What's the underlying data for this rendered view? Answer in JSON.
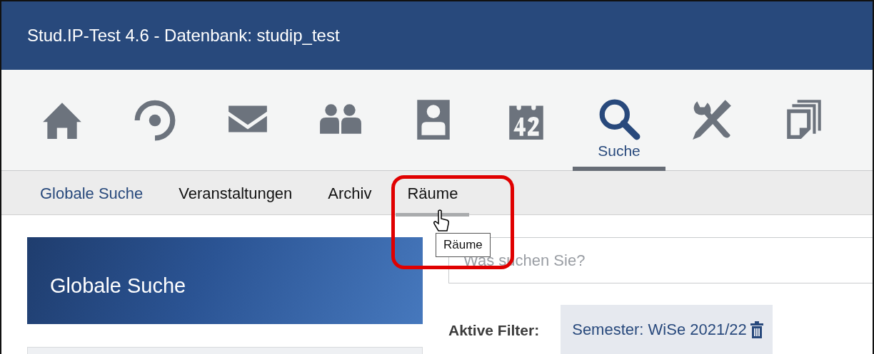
{
  "window": {
    "title": "Stud.IP-Test 4.6 - Datenbank: studip_test"
  },
  "nav": [
    {
      "kind": "home",
      "selected": false
    },
    {
      "kind": "activity",
      "selected": false
    },
    {
      "kind": "messages",
      "selected": false
    },
    {
      "kind": "community",
      "selected": false
    },
    {
      "kind": "profile",
      "selected": false
    },
    {
      "kind": "calendar",
      "selected": false
    },
    {
      "kind": "search",
      "label": "Suche",
      "selected": true
    },
    {
      "kind": "tools",
      "selected": false
    },
    {
      "kind": "files",
      "selected": false
    }
  ],
  "subnav": [
    {
      "label": "Globale Suche",
      "selected": true,
      "hovered": false
    },
    {
      "label": "Veranstaltungen",
      "selected": false,
      "hovered": false
    },
    {
      "label": "Archiv",
      "selected": false,
      "hovered": false
    },
    {
      "label": "Räume",
      "selected": false,
      "hovered": true
    }
  ],
  "tooltip": "Räume",
  "sidebar": {
    "title": "Globale Suche"
  },
  "search": {
    "placeholder": "Was suchen Sie?"
  },
  "filters": {
    "label": "Aktive Filter:",
    "items": [
      "Semester: WiSe 2021/22"
    ]
  }
}
